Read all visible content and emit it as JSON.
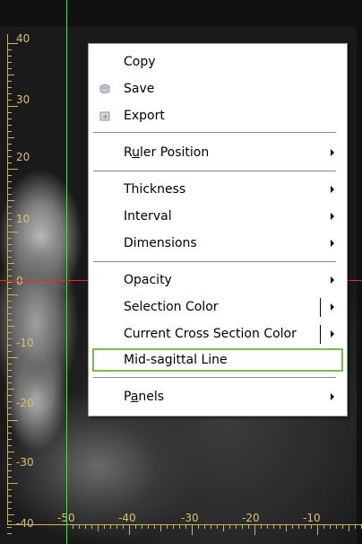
{
  "ruler": {
    "vertical_labels": [
      "40",
      "30",
      "20",
      "10",
      "0",
      "-10",
      "-20",
      "-30",
      "-40"
    ],
    "horizontal_labels": [
      "-50",
      "-40",
      "-30",
      "-20",
      "-10"
    ]
  },
  "colors": {
    "ruler": "#d8c26d",
    "crosshair_vertical": "#1aff1a",
    "crosshair_horizontal": "#ff2020",
    "menu_highlight_border": "#7bbd4c"
  },
  "menu": {
    "copy": "Copy",
    "save": "Save",
    "export": "Export",
    "ruler_position": {
      "pre": "R",
      "u": "u",
      "post": "ler Position"
    },
    "thickness": "Thickness",
    "interval": "Interval",
    "dimensions": "Dimensions",
    "opacity": "Opacity",
    "selection_color": "Selection Color",
    "current_cross_section_color": "Current Cross Section Color",
    "mid_sagittal_line": "Mid-sagittal Line",
    "panels": {
      "pre": "P",
      "u": "a",
      "post": "nels"
    },
    "icons": {
      "save": "save-icon",
      "export": "export-icon"
    }
  }
}
